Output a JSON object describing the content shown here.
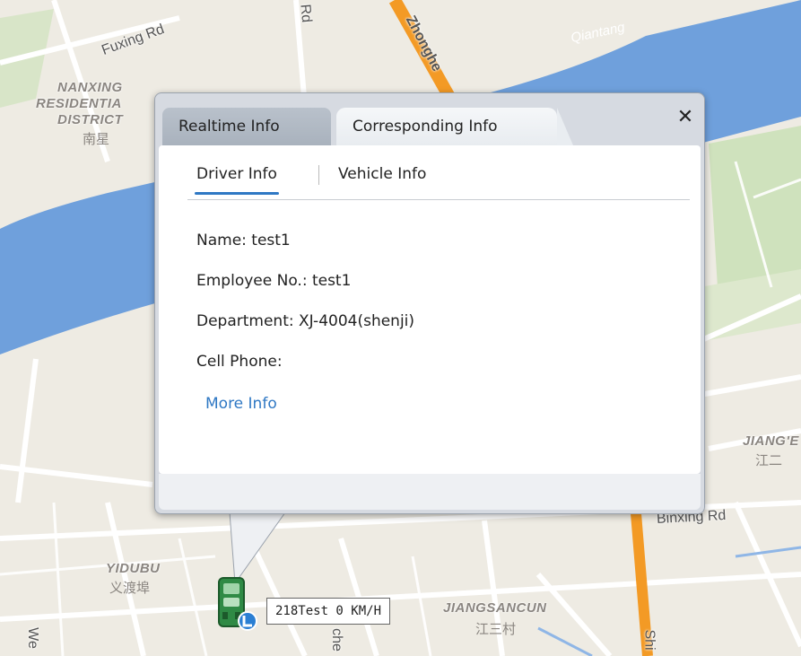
{
  "map": {
    "district_labels": [
      "NANXING",
      "RESIDENTIA",
      "DISTRICT",
      "YIDUBU",
      "JIANGSANCUN",
      "JIANG'E"
    ],
    "cjk_labels": [
      "南星",
      "义渡埠",
      "江三村",
      "江二"
    ],
    "road_labels": [
      "Fuxing Rd",
      "Rd",
      "Zhonghe",
      "Binxing Rd",
      "We",
      "Shi",
      "che"
    ],
    "water_labels": [
      "Qiantang"
    ],
    "colors": {
      "land": "#eeebe3",
      "water": "#6fa0dc",
      "green": "#cfe2bd",
      "road": "#ffffff",
      "highway": "#f39a25"
    }
  },
  "popup": {
    "tabs": [
      "Realtime Info",
      "Corresponding Info"
    ],
    "close_icon": "close-icon",
    "subtabs": [
      "Driver Info",
      "Vehicle Info"
    ],
    "active_subtab": "Driver Info",
    "rows": [
      {
        "label": "Name:",
        "value": "test1",
        "text": "Name: test1"
      },
      {
        "label": "Employee No.:",
        "value": "test1",
        "text": "Employee No.: test1"
      },
      {
        "label": "Department:",
        "value": "XJ-4004(shenji)",
        "text": "Department: XJ-4004(shenji)"
      },
      {
        "label": "Cell Phone:",
        "value": "",
        "text": "Cell Phone:"
      }
    ],
    "more_info": "More Info",
    "accent_color": "#2f78c4"
  },
  "vehicle": {
    "icon": "bus-icon",
    "label": "218Test 0 KM/H"
  }
}
